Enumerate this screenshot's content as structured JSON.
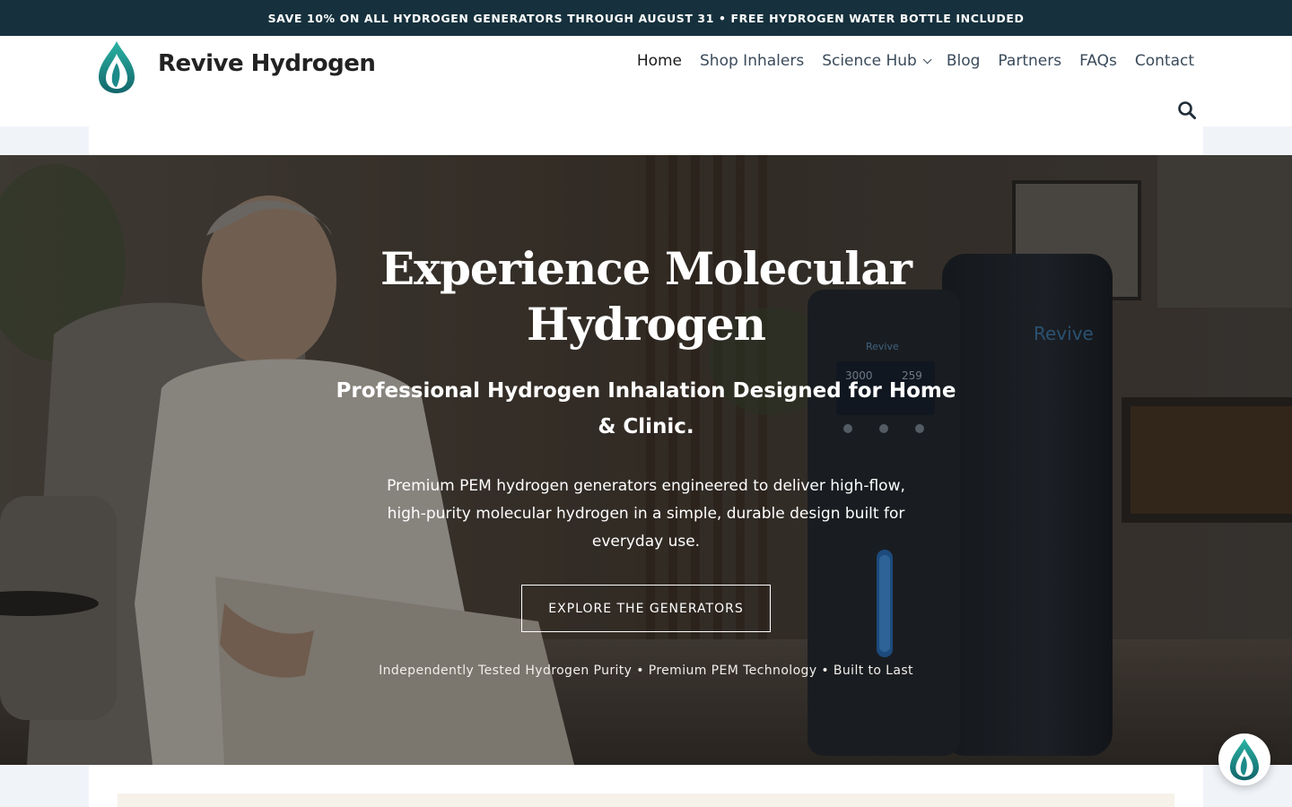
{
  "announcement": "SAVE 10% ON ALL HYDROGEN GENERATORS THROUGH AUGUST 31 • FREE HYDROGEN WATER BOTTLE INCLUDED",
  "brand": {
    "name": "Revive Hydrogen",
    "logo_icon": "droplet-leaf-logo",
    "colors": {
      "primary": "#1c8a8a",
      "dark": "#16313d",
      "accent": "#2bb3a3"
    }
  },
  "nav": {
    "items": [
      {
        "label": "Home",
        "active": true
      },
      {
        "label": "Shop Inhalers"
      },
      {
        "label": "Science Hub",
        "has_dropdown": true
      },
      {
        "label": "Blog"
      },
      {
        "label": "Partners"
      },
      {
        "label": "FAQs"
      },
      {
        "label": "Contact"
      }
    ],
    "search_icon": "search-icon"
  },
  "hero": {
    "title": "Experience Molecular Hydrogen",
    "subtitle": "Professional Hydrogen Inhalation Designed for Home & Clinic.",
    "description": "Premium PEM hydrogen generators engineered to deliver high-flow, high-purity molecular hydrogen in a simple, durable design built for everyday use.",
    "cta": "EXPLORE THE GENERATORS",
    "trust_line": "Independently Tested Hydrogen Purity • Premium PEM Technology • Built to Last",
    "device_brand": "Revive",
    "device_readouts": [
      "3000",
      "259"
    ]
  },
  "chat": {
    "icon": "droplet-leaf-chat-icon"
  }
}
